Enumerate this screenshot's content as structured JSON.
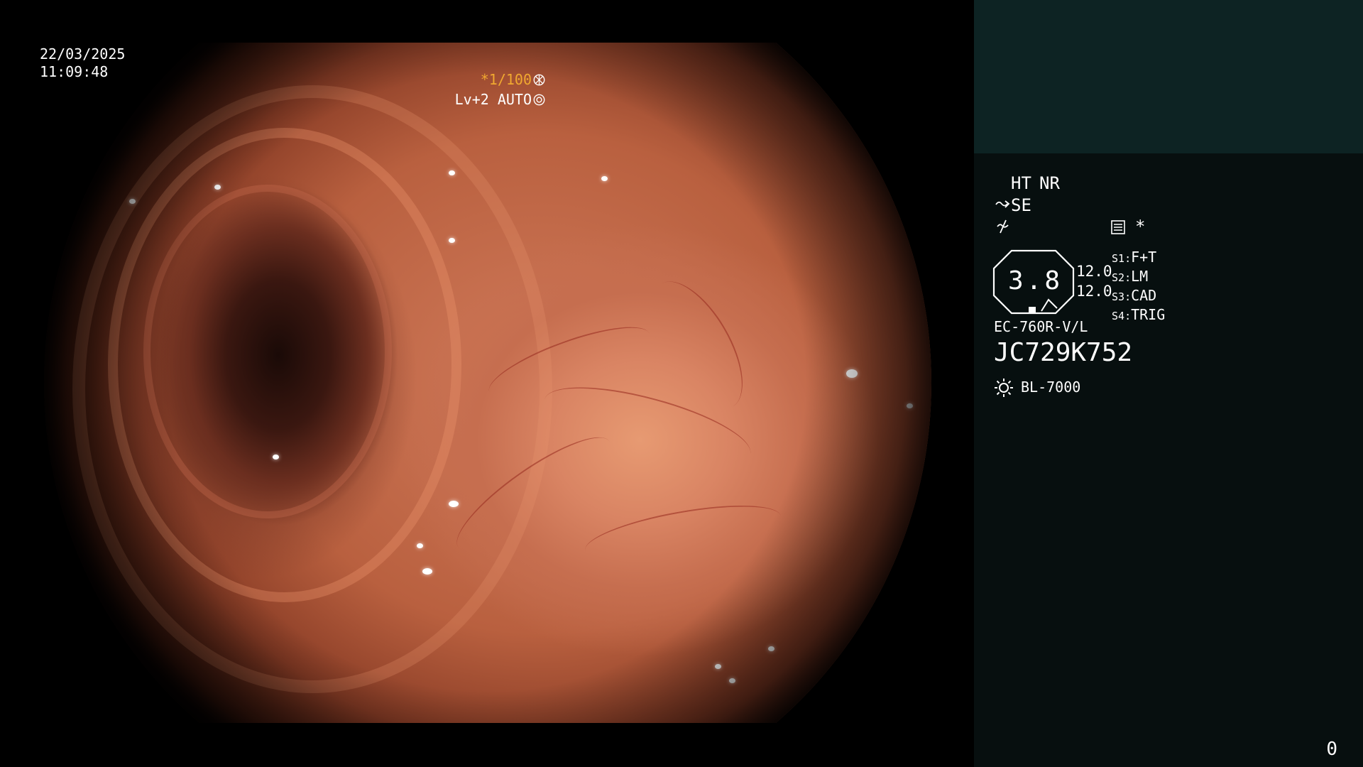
{
  "overlay": {
    "date": "22/03/2025",
    "time": "11:09:48",
    "shutter": "*1/100",
    "shutter_icon": "aperture-icon",
    "level_mode": "Lv+2 AUTO",
    "level_icon": "iris-icon"
  },
  "panel": {
    "ht_label": "HT",
    "nr_label": "NR",
    "se_label": "SE",
    "se_icon": "tilde-arrow-icon",
    "edge_icon": "slash-wave-icon",
    "mode_icon": "menu-list-icon",
    "asterisk": "*",
    "dial_value": "3.8",
    "value_upper": "12.0",
    "value_lower": "12.0",
    "switches": [
      {
        "key": "S1",
        "value": "F+T"
      },
      {
        "key": "S2",
        "value": "LM"
      },
      {
        "key": "S3",
        "value": "CAD"
      },
      {
        "key": "S4",
        "value": "TRIG"
      }
    ],
    "scope_model": "EC-760R-V/L",
    "serial": "JC729K752",
    "light_icon": "sun-icon",
    "light_source": "BL-7000",
    "frame_count": "0"
  },
  "colors": {
    "accent": "#f0a830",
    "panel_bg": "#070f0f",
    "panel_top_bg": "#0d2323",
    "text": "#ffffff"
  }
}
